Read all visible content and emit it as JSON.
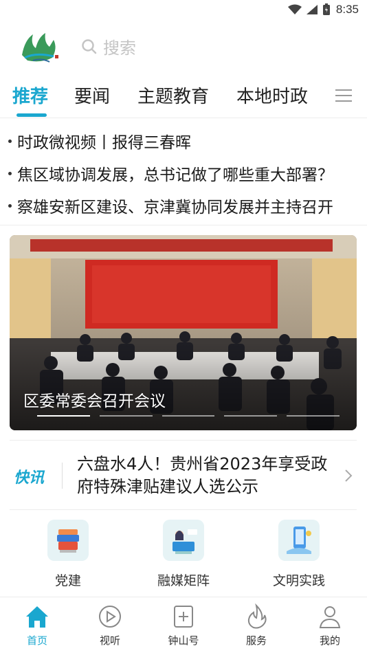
{
  "status_bar": {
    "time": "8:35",
    "icons": [
      "wifi-icon",
      "signal-icon",
      "battery-icon"
    ]
  },
  "header": {
    "search_placeholder": "搜索"
  },
  "tabs": [
    {
      "label": "推荐",
      "active": true
    },
    {
      "label": "要闻",
      "active": false
    },
    {
      "label": "主题教育",
      "active": false
    },
    {
      "label": "本地时政",
      "active": false
    }
  ],
  "headlines": [
    "时政微视频丨报得三春晖",
    "焦区域协调发展，总书记做了哪些重大部署？",
    "察雄安新区建设、京津冀协同发展并主持召开"
  ],
  "banner": {
    "caption": "区委常委会召开会议",
    "slide_count": 5,
    "active_slide": 0
  },
  "flash_news": {
    "logo": "快讯",
    "text": "六盘水4人！贵州省2023年享受政府特殊津贴建议人选公示"
  },
  "quick_links": [
    {
      "label": "党建",
      "icon": "books-icon"
    },
    {
      "label": "融媒矩阵",
      "icon": "news-anchor-icon"
    },
    {
      "label": "文明实践",
      "icon": "mobile-practice-icon"
    }
  ],
  "bottom_nav": [
    {
      "label": "首页",
      "icon": "home-icon",
      "active": true
    },
    {
      "label": "视听",
      "icon": "play-icon",
      "active": false
    },
    {
      "label": "钟山号",
      "icon": "add-square-icon",
      "active": false
    },
    {
      "label": "服务",
      "icon": "flame-icon",
      "active": false
    },
    {
      "label": "我的",
      "icon": "user-icon",
      "active": false
    }
  ],
  "colors": {
    "accent": "#1aa7cf",
    "text": "#1a1a1a",
    "muted": "#c4c4c4"
  }
}
